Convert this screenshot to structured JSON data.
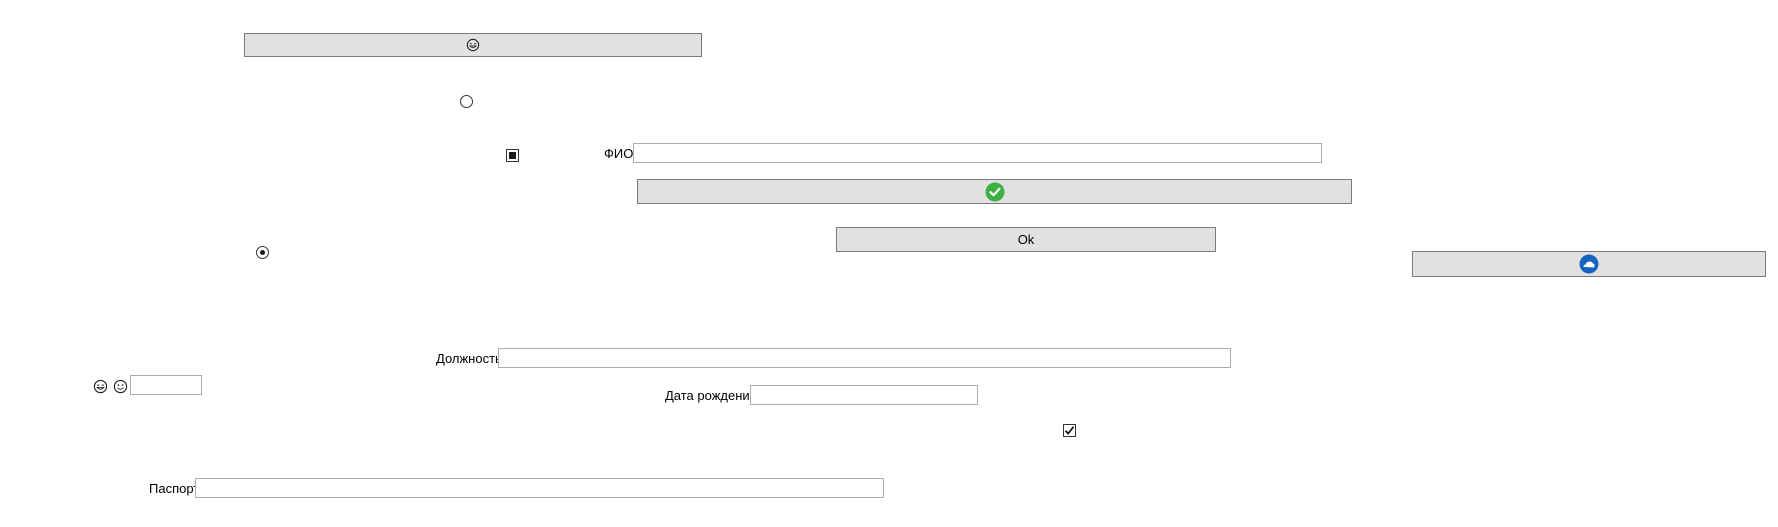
{
  "buttons": {
    "emoji_button_icon": "grinning-tears-face-icon",
    "check_button_icon": "green-check-circle-icon",
    "ok_label": "Ok",
    "cloud_button_icon": "blue-cloud-circle-icon"
  },
  "fields": {
    "fio_label": "ФИО",
    "fio_value": "",
    "position_label": "Должность",
    "position_value": "",
    "birthdate_label": "Дата рождения",
    "birthdate_value": "",
    "passport_label": "Паспорт",
    "passport_value": "",
    "small_value": ""
  },
  "controls": {
    "radio_top_checked": false,
    "radio_left_checked": true,
    "checkbox_indeterminate": true,
    "checkbox_checked": true
  },
  "icons": {
    "emoji_a": "laughing-face-icon",
    "emoji_b": "smiling-face-icon"
  },
  "colors": {
    "button_bg": "#e1e1e1",
    "check_green": "#3cb043",
    "cloud_blue": "#1565c0"
  }
}
